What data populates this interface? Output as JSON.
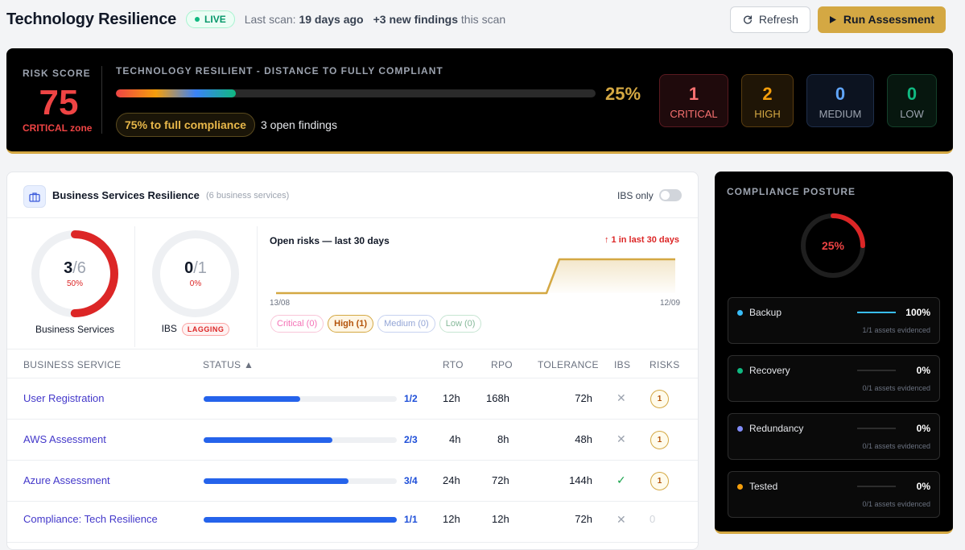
{
  "header": {
    "title": "Technology Resilience",
    "live_label": "LIVE",
    "last_scan_prefix": "Last scan:",
    "last_scan_value": "19 days ago",
    "findings_count": "+3 new findings",
    "findings_suffix": "this scan",
    "refresh_label": "Refresh",
    "run_label": "Run Assessment"
  },
  "risk": {
    "label": "RISK SCORE",
    "score": "75",
    "zone": "CRITICAL zone",
    "progress_title": "TECHNOLOGY RESILIENT - DISTANCE TO FULLY COMPLIANT",
    "progress_fraction": 0.25,
    "progress_pct": "25%",
    "compliance_pill": "75% to full compliance",
    "open_findings": "3 open findings",
    "severity": [
      {
        "count": "1",
        "label": "CRITICAL",
        "color": "#f87171"
      },
      {
        "count": "2",
        "label": "HIGH",
        "color": "#f59e0b"
      },
      {
        "count": "0",
        "label": "MEDIUM",
        "color": "#60a5fa"
      },
      {
        "count": "0",
        "label": "LOW",
        "color": "#10b981"
      }
    ]
  },
  "bsr": {
    "title": "Business Services Resilience",
    "subtitle": "(6 business services)",
    "ibs_only_label": "IBS only",
    "ibs_only_on": false,
    "donut_services": {
      "num": "3",
      "den": "/6",
      "pct": "50%",
      "caption": "Business Services",
      "fraction": 0.5
    },
    "donut_ibs": {
      "num": "0",
      "den": "/1",
      "pct": "0%",
      "caption": "IBS",
      "badge": "LAGGING",
      "fraction": 0
    },
    "chart": {
      "title": "Open risks — last 30 days",
      "delta": "↑ 1 in last 30 days",
      "date_start": "13/08",
      "date_end": "12/09",
      "chips": {
        "critical": "Critical (0)",
        "high": "High (1)",
        "medium": "Medium (0)",
        "low": "Low (0)"
      }
    },
    "columns": {
      "service": "BUSINESS SERVICE",
      "status": "STATUS ▲",
      "rto": "RTO",
      "rpo": "RPO",
      "tolerance": "TOLERANCE",
      "ibs": "IBS",
      "risks": "RISKS"
    },
    "rows": [
      {
        "name": "User Registration",
        "fraction": 0.5,
        "frac_label": "1/2",
        "rto": "12h",
        "rpo": "168h",
        "tolerance": "72h",
        "ibs": false,
        "risks": "1"
      },
      {
        "name": "AWS Assessment",
        "fraction": 0.667,
        "frac_label": "2/3",
        "rto": "4h",
        "rpo": "8h",
        "tolerance": "48h",
        "ibs": false,
        "risks": "1"
      },
      {
        "name": "Azure Assessment",
        "fraction": 0.75,
        "frac_label": "3/4",
        "rto": "24h",
        "rpo": "72h",
        "tolerance": "144h",
        "ibs": true,
        "risks": "1"
      },
      {
        "name": "Compliance: Tech Resilience",
        "fraction": 1.0,
        "frac_label": "1/1",
        "rto": "12h",
        "rpo": "12h",
        "tolerance": "72h",
        "ibs": false,
        "risks": "0"
      }
    ]
  },
  "posture": {
    "title": "COMPLIANCE POSTURE",
    "pct": "25%",
    "fraction": 0.25,
    "items": [
      {
        "name": "Backup",
        "value": "100%",
        "fraction": 1.0,
        "sub": "1/1 assets evidenced",
        "color": "#38bdf8"
      },
      {
        "name": "Recovery",
        "value": "0%",
        "fraction": 0,
        "sub": "0/1 assets evidenced",
        "color": "#10b981"
      },
      {
        "name": "Redundancy",
        "value": "0%",
        "fraction": 0,
        "sub": "0/1 assets evidenced",
        "color": "#818cf8"
      },
      {
        "name": "Tested",
        "value": "0%",
        "fraction": 0,
        "sub": "0/1 assets evidenced",
        "color": "#f59e0b"
      }
    ]
  }
}
